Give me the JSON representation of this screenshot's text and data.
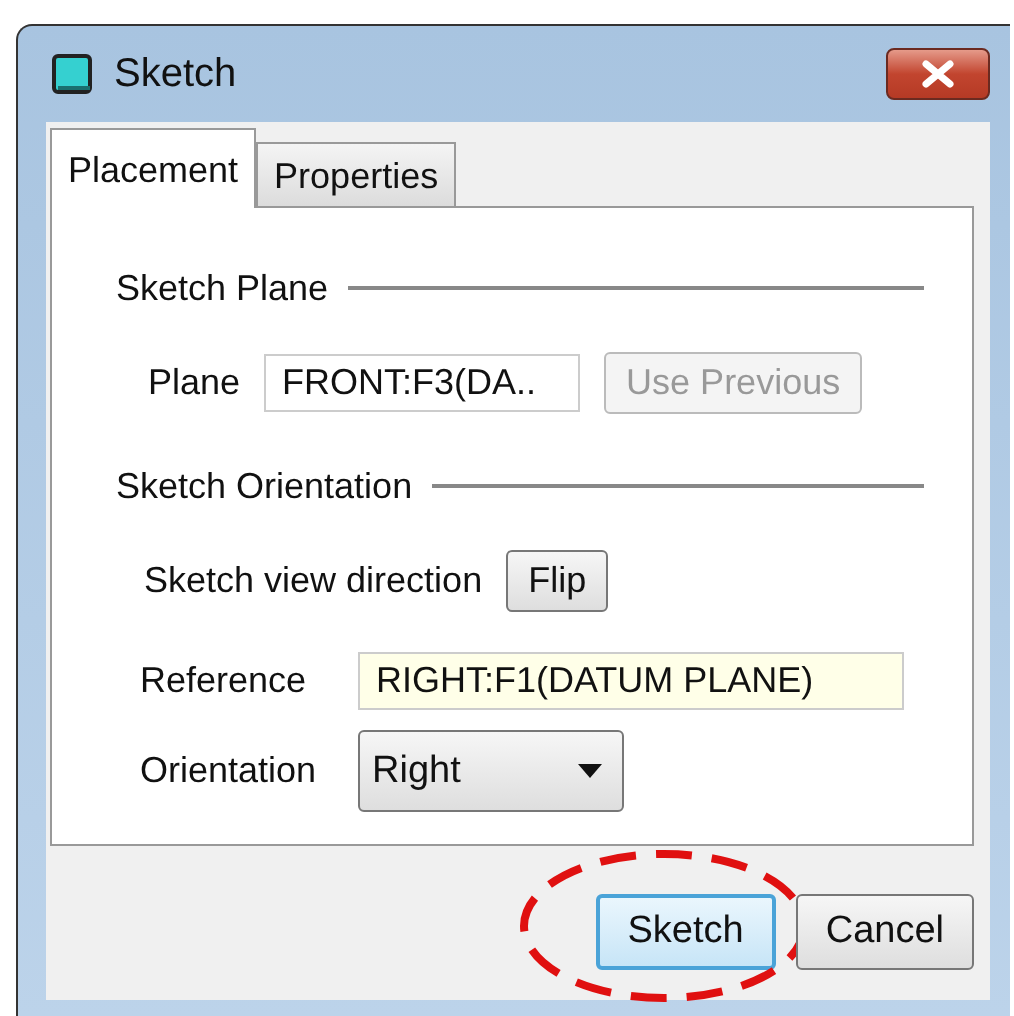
{
  "window": {
    "title": "Sketch"
  },
  "tabs": [
    {
      "label": "Placement",
      "selected": true
    },
    {
      "label": "Properties",
      "selected": false
    }
  ],
  "sketch_plane": {
    "heading": "Sketch Plane",
    "plane_label": "Plane",
    "plane_value": "FRONT:F3(DA..",
    "use_previous": {
      "label": "Use Previous",
      "disabled": true
    }
  },
  "sketch_orientation": {
    "heading": "Sketch Orientation",
    "view_direction_label": "Sketch view direction",
    "flip_button": "Flip",
    "reference_label": "Reference",
    "reference_value": "RIGHT:F1(DATUM PLANE)",
    "reference_highlighted": true,
    "orientation_label": "Orientation",
    "orientation_value": "Right"
  },
  "buttons": [
    {
      "label": "Sketch",
      "default": true,
      "circled": true
    },
    {
      "label": "Cancel",
      "default": false,
      "circled": false
    }
  ]
}
